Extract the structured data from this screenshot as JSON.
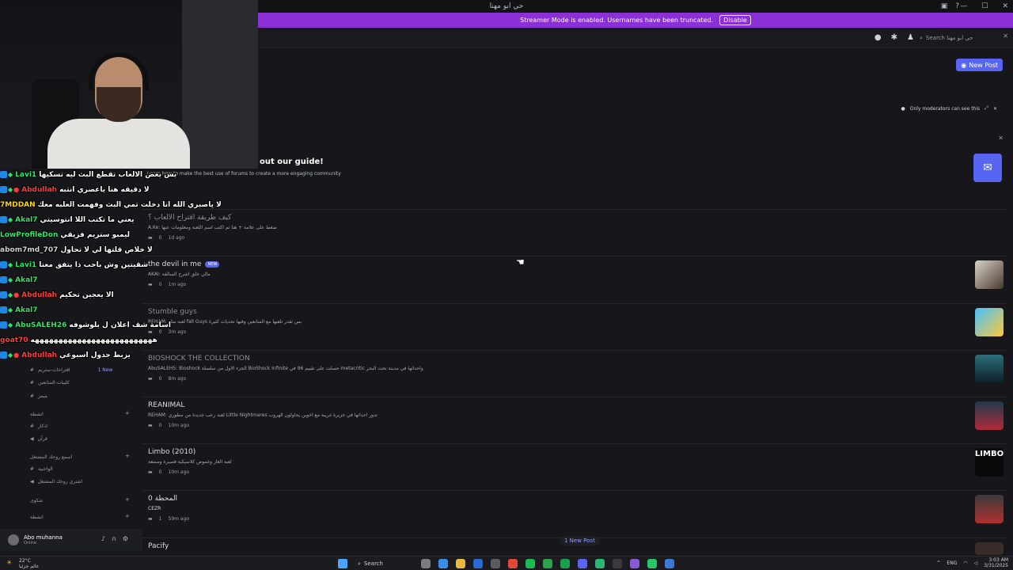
{
  "titlebar": {
    "title": "حي ابو مهنا",
    "controls": [
      "—",
      "☐",
      "✕"
    ]
  },
  "streamer_mode": {
    "message": "Streamer Mode is enabled. Usernames have been truncated.",
    "disable_label": "Disable"
  },
  "header": {
    "search_placeholder": "Search حي ابو مهنا"
  },
  "toolbar": {
    "new_post_label": "New Post"
  },
  "mods_note": "Only moderators can see this",
  "guide": {
    "title": "out our guide!",
    "subtitle": "Learn how to make the best use of forums to create a more engaging community"
  },
  "posts": [
    {
      "title": "كيف طريقة اقتراح الالعاب ؟",
      "author": "A.Ke:",
      "preview": "ضغط على علامة + هنا ثم اكتب اسم اللعبة ومعلومات عنها",
      "replies": "0",
      "time": "1d ago",
      "dim": true,
      "new": false
    },
    {
      "title": "the devil in me",
      "author": "AKAI:",
      "preview": "مالي خلق اشرح السالفة",
      "replies": "0",
      "time": "1m ago",
      "dim": false,
      "new": true,
      "badge": "NEW"
    },
    {
      "title": "Stumble guys",
      "author": "REHAM:",
      "preview": "لعبة مثل fall Guys بس تقدر تلعبها مع المتابعين وفيها تحديات كثيرة",
      "replies": "0",
      "time": "3m ago",
      "dim": true,
      "new": false
    },
    {
      "title": "BIOSHOCK THE COLLECTION",
      "author": "AbuSALEH5:",
      "preview": "Bioshock الجزء الاول من سلسلة BioShock Infinite حصلت على تقييم 96 في metacritic واحداثها في مدينة تحت البحر",
      "replies": "0",
      "time": "8m ago",
      "dim": true,
      "new": false
    },
    {
      "title": "REANIMAL",
      "author": "REHAM:",
      "preview": "لعبة رعب جديدة من مطوري Little Nightmares تدور احداثها في جزيرة غريبة مع اخوين يحاولون الهروب",
      "replies": "0",
      "time": "10m ago",
      "dim": false,
      "new": false
    },
    {
      "title": "Limbo (2010)",
      "author": "",
      "preview": "لعبة الغاز وغموض كلاسيكية قصيرة وممتعة",
      "replies": "0",
      "time": "10m ago",
      "dim": false,
      "new": false
    },
    {
      "title": "المحطة 0",
      "author": "CEZR",
      "preview": "",
      "replies": "1",
      "time": "59m ago",
      "dim": false,
      "new": false
    },
    {
      "title": "Pacify",
      "author": "",
      "preview": "",
      "replies": "",
      "time": "",
      "dim": false,
      "new": false
    }
  ],
  "new_post_pill": "1 New Post",
  "channels": [
    {
      "name": "اقتراحات-ستريم",
      "badge": "1 New"
    },
    {
      "name": "كليبات-المتابعين"
    },
    {
      "name": "ميمز"
    },
    {
      "name": "انشطة"
    },
    {
      "name": "اذكار"
    },
    {
      "name": "قرآن"
    },
    {
      "name": "اسمع روحك المشتغل"
    },
    {
      "name": "الواجبية"
    },
    {
      "name": "اشتري روحك المشتغل"
    },
    {
      "name": "شكوى"
    },
    {
      "name": "انشطة"
    }
  ],
  "user_panel": {
    "name": "Abo muhanna",
    "status": "Online"
  },
  "chat": [
    {
      "user": "Lavi1",
      "color": "#2ee66b",
      "msg": "بس بعض الالعاب تقطع البث ليه تسكيها"
    },
    {
      "user": "Abdullah",
      "color": "#ff3b3b",
      "msg": "لا دقيقه هنا ياعصري انتبه"
    },
    {
      "user": "7MDDAN",
      "color": "#ffd700",
      "msg": "لا ياصبري الله انا دخلت تمي البث وفهمت العلبه معك"
    },
    {
      "user": "Akal7",
      "color": "#2ee66b",
      "msg": "يعني ما تكتب اللا انتوسيتي"
    },
    {
      "user": "LowProfileDon",
      "color": "#2ee66b",
      "msg": "ليمبو ستريم فزيقي"
    },
    {
      "user": "abom7md_707",
      "color": "#d0d2d6",
      "msg": "لا خلاص قلتها لي لا تحاول"
    },
    {
      "user": "Lavi1",
      "color": "#2ee66b",
      "msg": "شقيتين وش باحب ذا يتفق معنا"
    },
    {
      "user": "Akal7",
      "color": "#2ee66b",
      "msg": ""
    },
    {
      "user": "Abdullah",
      "color": "#ff3b3b",
      "msg": "الا يعجبن تحكيم"
    },
    {
      "user": "Akal7",
      "color": "#2ee66b",
      "msg": ""
    },
    {
      "user": "AbuSALEH26",
      "color": "#2ee66b",
      "msg": "اسامة شف اعلان ل بلوشوفه"
    },
    {
      "user": "goat70",
      "color": "#ff3b3b",
      "msg": "ههههههههههههههههههههههههههه"
    },
    {
      "user": "Abdullah",
      "color": "#ff3b3b",
      "msg": "يزبط جدول اسبوعي"
    }
  ],
  "taskbar": {
    "weather_temp": "22°C",
    "weather_desc": "غائم جزئيا",
    "search_label": "Search",
    "lang": "ENG",
    "time": "3:03 AM",
    "date": "3/31/2025"
  },
  "colors": {
    "accent": "#5865f2",
    "streamer_bar": "#8b2fd6",
    "background": "#17171b"
  }
}
